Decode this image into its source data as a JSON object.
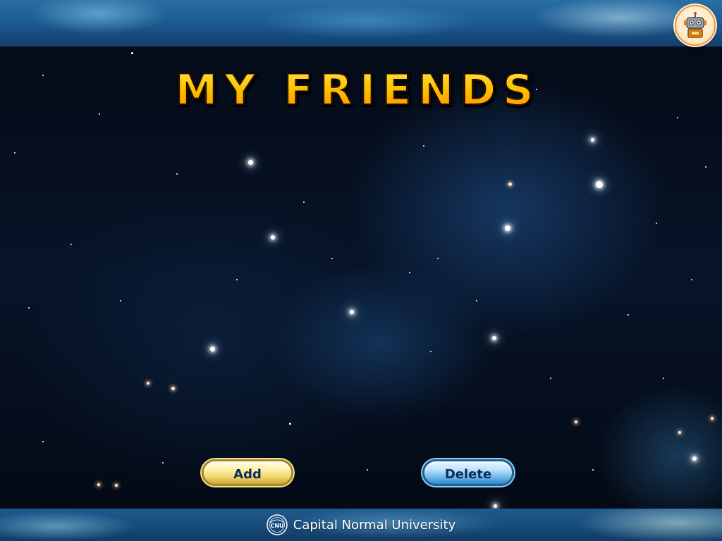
{
  "app": {
    "title": "MY FRIENDS"
  },
  "buttons": {
    "add_label": "Add",
    "delete_label": "Delete"
  },
  "footer": {
    "logo_text": "CNU",
    "university": "Capital Normal University"
  },
  "icons": {
    "avatar": "robot-icon",
    "footer_logo": "university-seal-icon"
  },
  "colors": {
    "title_fill": "#ffc400",
    "title_stroke": "#1a0a00",
    "add_button": "#f1d56a",
    "delete_button": "#6fb9ea",
    "button_text": "#0e2a5c",
    "footer_text": "#ffffff"
  }
}
